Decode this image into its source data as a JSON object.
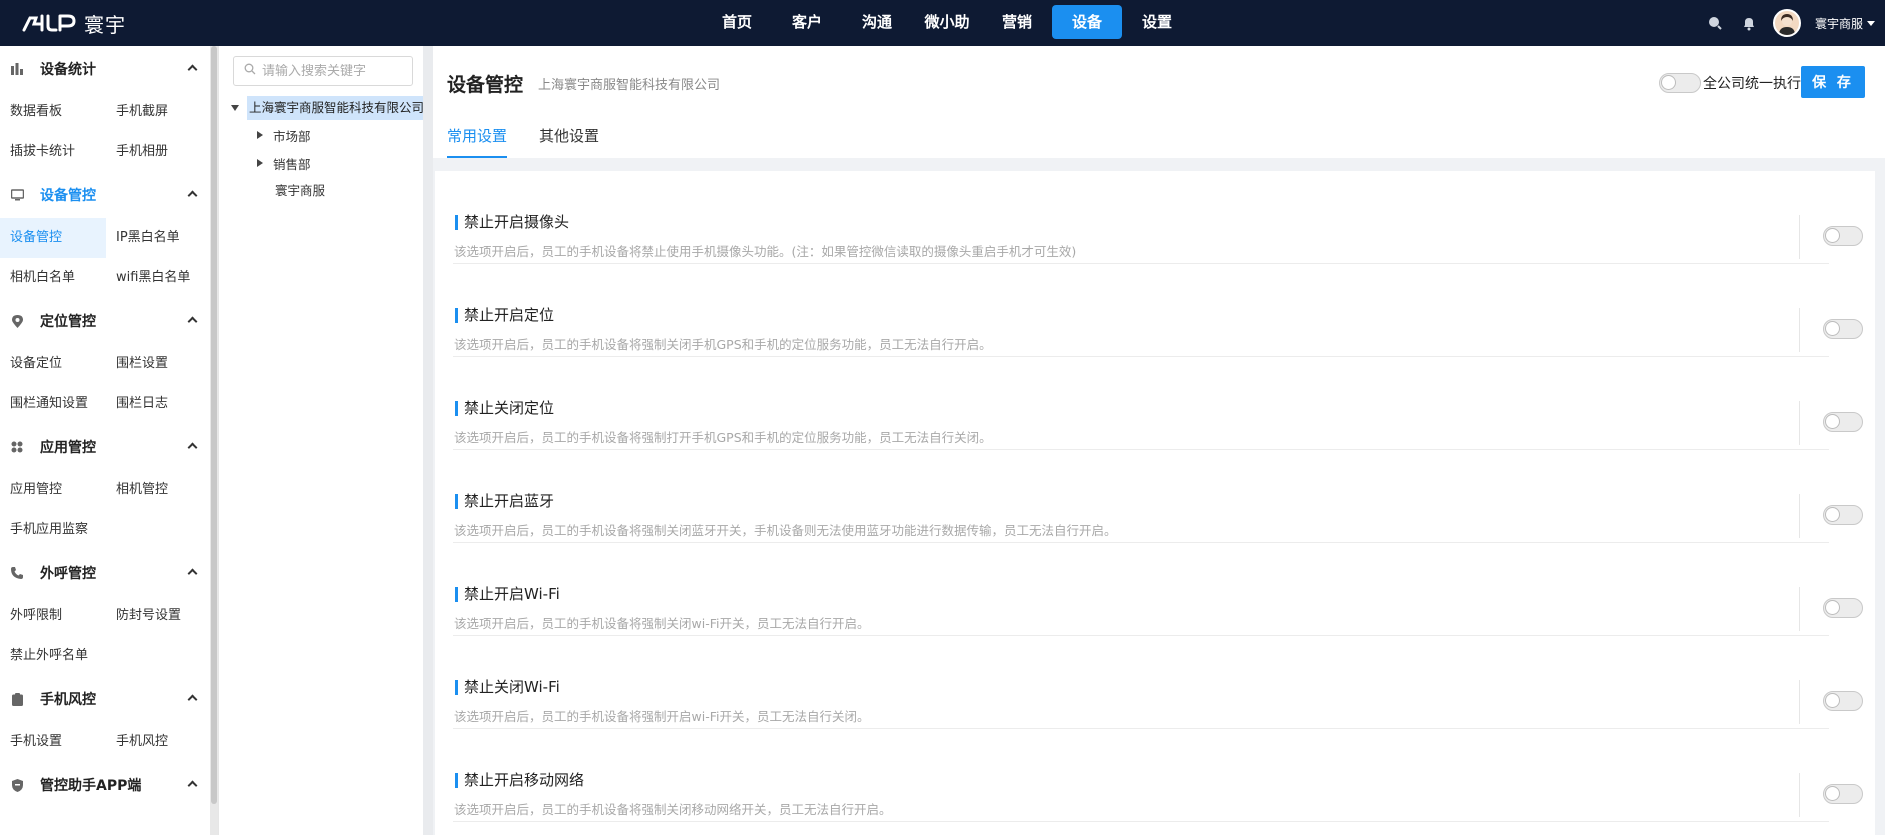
{
  "app": {
    "logo_text": "寰宇",
    "nav": [
      "首页",
      "客户",
      "沟通",
      "微小助",
      "营销",
      "设备",
      "设置"
    ],
    "nav_active_index": 5,
    "user_name": "寰宇商服"
  },
  "sidebar": {
    "groups": [
      {
        "title": "设备统计",
        "icon": "bar-chart-icon",
        "items": [
          "数据看板",
          "手机截屏",
          "插拔卡统计",
          "手机相册"
        ]
      },
      {
        "title": "设备管控",
        "icon": "device-icon",
        "active": true,
        "items": [
          "设备管控",
          "IP黑白名单",
          "相机白名单",
          "wifi黑白名单"
        ],
        "active_item": "设备管控"
      },
      {
        "title": "定位管控",
        "icon": "location-icon",
        "items": [
          "设备定位",
          "围栏设置",
          "围栏通知设置",
          "围栏日志"
        ]
      },
      {
        "title": "应用管控",
        "icon": "apps-icon",
        "items": [
          "应用管控",
          "相机管控",
          "手机应用监察"
        ]
      },
      {
        "title": "外呼管控",
        "icon": "phone-icon",
        "items": [
          "外呼限制",
          "防封号设置",
          "禁止外呼名单"
        ]
      },
      {
        "title": "手机风控",
        "icon": "clipboard-icon",
        "items": [
          "手机设置",
          "手机风控"
        ]
      },
      {
        "title": "管控助手APP端",
        "icon": "shield-icon",
        "items": []
      }
    ]
  },
  "tree": {
    "search_placeholder": "请输入搜索关键字",
    "root": "上海寰宇商服智能科技有限公司",
    "children": [
      "市场部",
      "销售部"
    ],
    "leaf": "寰宇商服"
  },
  "main": {
    "title": "设备管控",
    "company": "上海寰宇商服智能科技有限公司",
    "global_toggle_label": "全公司统一执行",
    "save_label": "保 存",
    "tabs": [
      "常用设置",
      "其他设置"
    ],
    "active_tab": 0,
    "settings": [
      {
        "title": "禁止开启摄像头",
        "desc": "该选项开启后，员工的手机设备将禁止使用手机摄像头功能。(注：如果管控微信读取的摄像头重启手机才可生效)",
        "enabled": false
      },
      {
        "title": "禁止开启定位",
        "desc": "该选项开启后，员工的手机设备将强制关闭手机GPS和手机的定位服务功能，员工无法自行开启。",
        "enabled": false
      },
      {
        "title": "禁止关闭定位",
        "desc": "该选项开启后，员工的手机设备将强制打开手机GPS和手机的定位服务功能，员工无法自行关闭。",
        "enabled": false
      },
      {
        "title": "禁止开启蓝牙",
        "desc": "该选项开启后，员工的手机设备将强制关闭蓝牙开关，手机设备则无法使用蓝牙功能进行数据传输，员工无法自行开启。",
        "enabled": false
      },
      {
        "title": "禁止开启Wi-Fi",
        "desc": "该选项开启后，员工的手机设备将强制关闭wi-Fi开关，员工无法自行开启。",
        "enabled": false
      },
      {
        "title": "禁止关闭Wi-Fi",
        "desc": "该选项开启后，员工的手机设备将强制开启wi-Fi开关，员工无法自行关闭。",
        "enabled": false
      },
      {
        "title": "禁止开启移动网络",
        "desc": "该选项开启后，员工的手机设备将强制关闭移动网络开关，员工无法自行开启。",
        "enabled": false
      }
    ]
  },
  "colors": {
    "accent": "#1b8ff0",
    "topbar": "#0e1a33"
  }
}
